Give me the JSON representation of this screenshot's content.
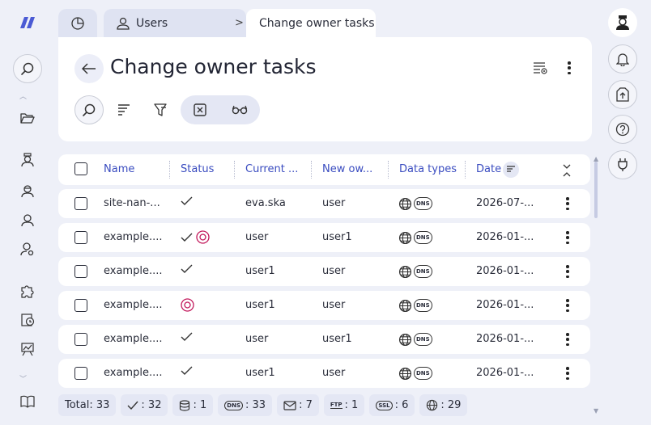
{
  "tabs": {
    "users_label": "Users",
    "active_label": "Change owner tasks"
  },
  "page": {
    "title": "Change owner tasks"
  },
  "table": {
    "columns": [
      "Name",
      "Status",
      "Current ...",
      "New ow...",
      "Data types",
      "Date"
    ],
    "rows": [
      {
        "name": "site-nan-...",
        "current": "eva.ska",
        "new": "user",
        "date": "2026-07-...",
        "done": true,
        "pending": false
      },
      {
        "name": "example....",
        "current": "user",
        "new": "user1",
        "date": "2026-01-...",
        "done": true,
        "pending": true
      },
      {
        "name": "example....",
        "current": "user1",
        "new": "user",
        "date": "2026-01-...",
        "done": true,
        "pending": false
      },
      {
        "name": "example....",
        "current": "user1",
        "new": "user",
        "date": "2026-01-...",
        "done": false,
        "pending": true
      },
      {
        "name": "example....",
        "current": "user",
        "new": "user1",
        "date": "2026-01-...",
        "done": true,
        "pending": false
      },
      {
        "name": "example....",
        "current": "user1",
        "new": "user",
        "date": "2026-01-...",
        "done": true,
        "pending": false
      }
    ],
    "dns_badge": "DNS"
  },
  "footer": {
    "total": "Total: 33",
    "done": ": 32",
    "db": ": 1",
    "dns_label": "DNS",
    "dns": ": 33",
    "mail": ": 7",
    "ftp_label": "FTP",
    "ftp": ": 1",
    "ssl_label": "SSL",
    "ssl": ": 6",
    "web": ": 29"
  },
  "colors": {
    "accent": "#3a4cc0",
    "pending": "#c2185b",
    "background": "#eef0f8"
  }
}
